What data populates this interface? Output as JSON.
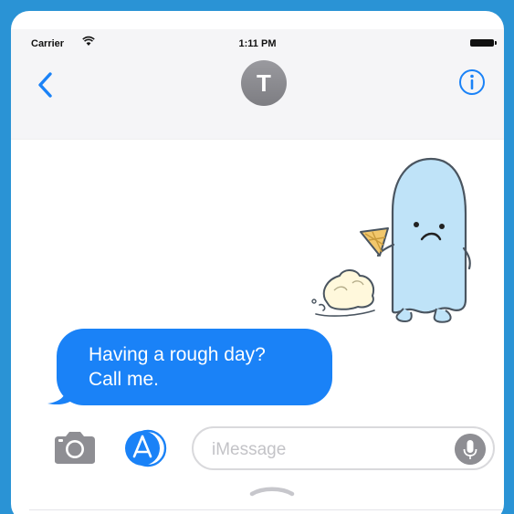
{
  "status_bar": {
    "carrier": "Carrier",
    "time": "1:11 PM"
  },
  "header": {
    "contact_initial": "T",
    "back_icon": "chevron-left-icon",
    "info_icon": "info-circle-icon"
  },
  "conversation": {
    "sticker": "sad-ghost-dropped-ice-cream-sticker",
    "message_lines": [
      "Having a rough day?",
      "Call me."
    ]
  },
  "composer": {
    "placeholder": "iMessage",
    "camera_icon": "camera-icon",
    "apps_icon": "app-store-icon",
    "mic_icon": "microphone-icon",
    "drawer_icon": "chevron-up-handle-icon"
  },
  "colors": {
    "background": "#2a93d5",
    "bubble": "#1a82f7",
    "accent": "#1a82f7",
    "avatar": "#8e8e93"
  }
}
